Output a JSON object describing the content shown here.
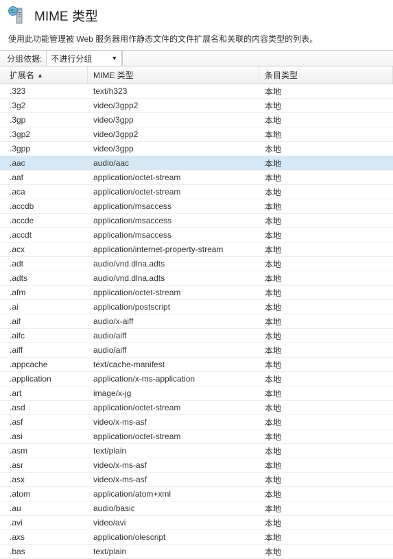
{
  "header": {
    "title": "MIME 类型"
  },
  "description": "使用此功能管理被 Web 服务器用作静态文件的文件扩展名和关联的内容类型的列表。",
  "toolbar": {
    "group_by_label": "分组依据:",
    "dropdown_value": "不进行分组"
  },
  "table": {
    "headers": {
      "extension": "扩展名",
      "mime_type": "MIME 类型",
      "entry_type": "条目类型"
    },
    "selected_index": 5,
    "rows": [
      {
        "ext": ".323",
        "mime": "text/h323",
        "entry": "本地"
      },
      {
        "ext": ".3g2",
        "mime": "video/3gpp2",
        "entry": "本地"
      },
      {
        "ext": ".3gp",
        "mime": "video/3gpp",
        "entry": "本地"
      },
      {
        "ext": ".3gp2",
        "mime": "video/3gpp2",
        "entry": "本地"
      },
      {
        "ext": ".3gpp",
        "mime": "video/3gpp",
        "entry": "本地"
      },
      {
        "ext": ".aac",
        "mime": "audio/aac",
        "entry": "本地"
      },
      {
        "ext": ".aaf",
        "mime": "application/octet-stream",
        "entry": "本地"
      },
      {
        "ext": ".aca",
        "mime": "application/octet-stream",
        "entry": "本地"
      },
      {
        "ext": ".accdb",
        "mime": "application/msaccess",
        "entry": "本地"
      },
      {
        "ext": ".accde",
        "mime": "application/msaccess",
        "entry": "本地"
      },
      {
        "ext": ".accdt",
        "mime": "application/msaccess",
        "entry": "本地"
      },
      {
        "ext": ".acx",
        "mime": "application/internet-property-stream",
        "entry": "本地"
      },
      {
        "ext": ".adt",
        "mime": "audio/vnd.dlna.adts",
        "entry": "本地"
      },
      {
        "ext": ".adts",
        "mime": "audio/vnd.dlna.adts",
        "entry": "本地"
      },
      {
        "ext": ".afm",
        "mime": "application/octet-stream",
        "entry": "本地"
      },
      {
        "ext": ".ai",
        "mime": "application/postscript",
        "entry": "本地"
      },
      {
        "ext": ".aif",
        "mime": "audio/x-aiff",
        "entry": "本地"
      },
      {
        "ext": ".aifc",
        "mime": "audio/aiff",
        "entry": "本地"
      },
      {
        "ext": ".aiff",
        "mime": "audio/aiff",
        "entry": "本地"
      },
      {
        "ext": ".appcache",
        "mime": "text/cache-manifest",
        "entry": "本地"
      },
      {
        "ext": ".application",
        "mime": "application/x-ms-application",
        "entry": "本地"
      },
      {
        "ext": ".art",
        "mime": "image/x-jg",
        "entry": "本地"
      },
      {
        "ext": ".asd",
        "mime": "application/octet-stream",
        "entry": "本地"
      },
      {
        "ext": ".asf",
        "mime": "video/x-ms-asf",
        "entry": "本地"
      },
      {
        "ext": ".asi",
        "mime": "application/octet-stream",
        "entry": "本地"
      },
      {
        "ext": ".asm",
        "mime": "text/plain",
        "entry": "本地"
      },
      {
        "ext": ".asr",
        "mime": "video/x-ms-asf",
        "entry": "本地"
      },
      {
        "ext": ".asx",
        "mime": "video/x-ms-asf",
        "entry": "本地"
      },
      {
        "ext": ".atom",
        "mime": "application/atom+xml",
        "entry": "本地"
      },
      {
        "ext": ".au",
        "mime": "audio/basic",
        "entry": "本地"
      },
      {
        "ext": ".avi",
        "mime": "video/avi",
        "entry": "本地"
      },
      {
        "ext": ".axs",
        "mime": "application/olescript",
        "entry": "本地"
      },
      {
        "ext": ".bas",
        "mime": "text/plain",
        "entry": "本地"
      }
    ]
  }
}
